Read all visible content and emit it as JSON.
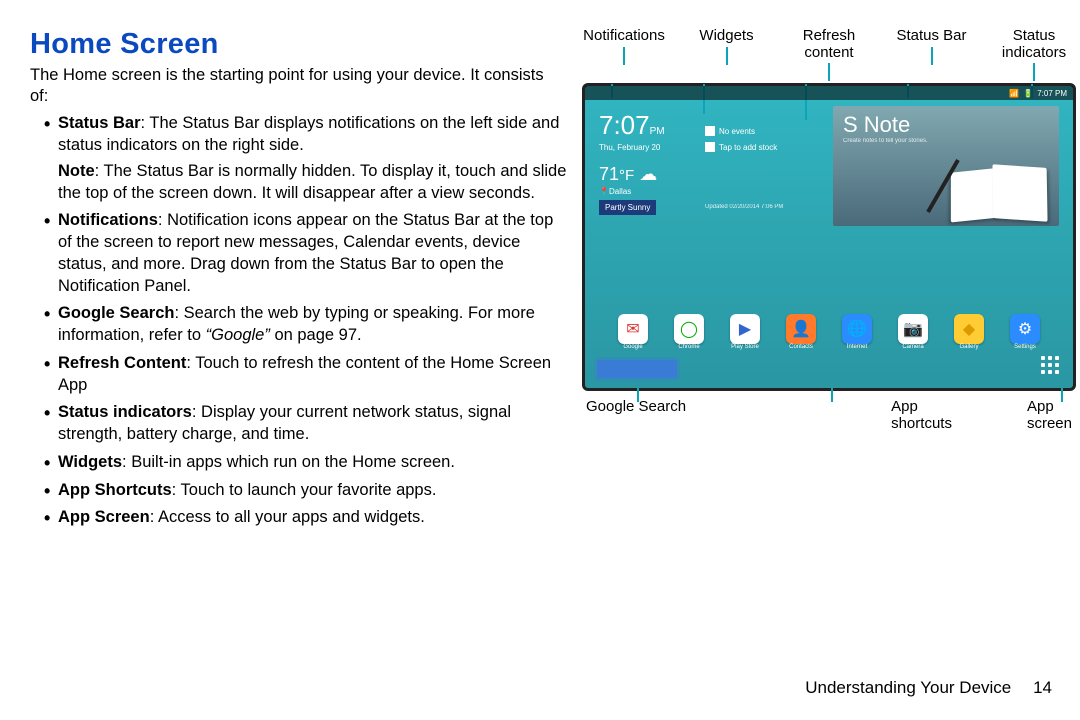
{
  "title": "Home Screen",
  "intro": "The Home screen is the starting point for using your device. It consists of:",
  "bullets": [
    {
      "term": "Status Bar",
      "body": ": The Status Bar displays notifications on the left side and status indicators on the right side.",
      "note_label": "Note",
      "note_body": ": The Status Bar is normally hidden. To display it, touch and slide the top of the screen down. It will disappear after a view seconds."
    },
    {
      "term": "Notifications",
      "body": ": Notification icons appear on the Status Bar at the top of the screen to report new messages, Calendar events, device status, and more. Drag down from the Status Bar to open the Notification Panel."
    },
    {
      "term": "Google Search",
      "body": ": Search the web by typing or speaking. For more information, refer to ",
      "ref_em": "“Google”",
      "ref_tail": " on page 97."
    },
    {
      "term": "Refresh Content",
      "body": ": Touch to refresh the content of the Home Screen App"
    },
    {
      "term": "Status indicators",
      "body": ": Display your current network status, signal strength, battery charge, and time."
    },
    {
      "term": "Widgets",
      "body": ": Built-in apps which run on the Home screen."
    },
    {
      "term": "App Shortcuts",
      "body": ": Touch to launch your favorite apps."
    },
    {
      "term": "App Screen",
      "body": ": Access to all your apps and widgets."
    }
  ],
  "annotations_top": [
    "Notifications",
    "Widgets",
    "Refresh\ncontent",
    "Status Bar",
    "Status\nindicators"
  ],
  "annotations_bottom": {
    "left": "Google Search",
    "mid": "App\nshortcuts",
    "right": "App\nscreen"
  },
  "device": {
    "status_time": "7:07 PM",
    "clock_time": "7:07",
    "clock_suffix": "PM",
    "date": "Thu, February 20",
    "temp": "71",
    "temp_unit": "°F",
    "city": "Dallas",
    "condition": "Partly Sunny",
    "mid_rows": [
      "No events",
      "Tap to add stock"
    ],
    "updated": "Updated 02/20/2014 7:06 PM",
    "snote_title": "S Note",
    "snote_sub": "Create notes to tell your stories.",
    "apps": [
      {
        "label": "Google",
        "color": "#ffffff",
        "glyph": "✉",
        "fg": "#d33"
      },
      {
        "label": "Chrome",
        "color": "#ffffff",
        "glyph": "◯",
        "fg": "#0a0"
      },
      {
        "label": "Play Store",
        "color": "#ffffff",
        "glyph": "▶",
        "fg": "#36c"
      },
      {
        "label": "Contacts",
        "color": "#ff7a2a",
        "glyph": "👤",
        "fg": "#fff"
      },
      {
        "label": "Internet",
        "color": "#2a8cff",
        "glyph": "🌐",
        "fg": "#fff"
      },
      {
        "label": "Camera",
        "color": "#ffffff",
        "glyph": "📷",
        "fg": "#333"
      },
      {
        "label": "Gallery",
        "color": "#ffcc33",
        "glyph": "◆",
        "fg": "#d90"
      },
      {
        "label": "Settings",
        "color": "#2a8cff",
        "glyph": "⚙",
        "fg": "#fff"
      }
    ]
  },
  "footer": {
    "section": "Understanding Your Device",
    "page": "14"
  }
}
